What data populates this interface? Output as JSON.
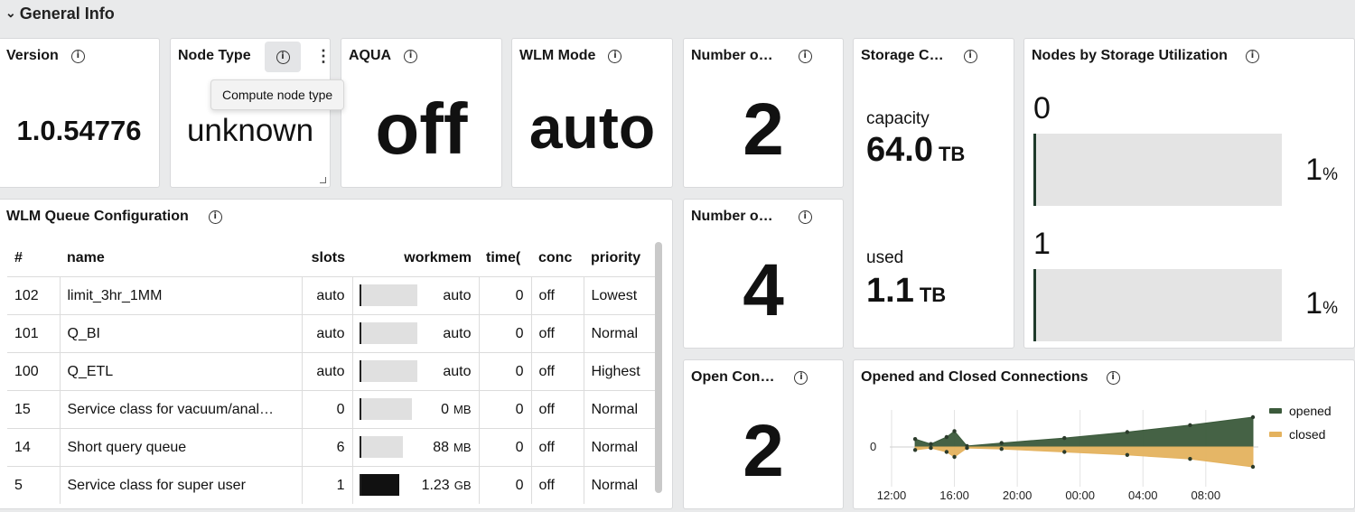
{
  "section": {
    "title": "General Info"
  },
  "version": {
    "title": "Version",
    "value": "1.0.54776"
  },
  "node_type": {
    "title": "Node Type",
    "value": "unknown",
    "tooltip": "Compute node type"
  },
  "aqua": {
    "title": "AQUA",
    "value": "off"
  },
  "wlm_mode": {
    "title": "WLM Mode",
    "value": "auto"
  },
  "number_of_1": {
    "title": "Number o…",
    "value": "2"
  },
  "number_of_2": {
    "title": "Number o…",
    "value": "4"
  },
  "open_connections": {
    "title": "Open Con…",
    "value": "2"
  },
  "storage": {
    "title": "Storage C…",
    "capacity_label": "capacity",
    "capacity_value": "64.0",
    "capacity_unit": "TB",
    "used_label": "used",
    "used_value": "1.1",
    "used_unit": "TB"
  },
  "nodes_storage": {
    "title": "Nodes by Storage Utilization",
    "nodes": [
      {
        "index": "0",
        "percent": "1",
        "unit": "%",
        "fraction": 0.01
      },
      {
        "index": "1",
        "percent": "1",
        "unit": "%",
        "fraction": 0.01
      }
    ]
  },
  "wlm_queue": {
    "title": "WLM Queue Configuration",
    "columns": [
      "#",
      "name",
      "slots",
      "workmem",
      "time(",
      "conc",
      "priority"
    ],
    "rows": [
      {
        "id": "102",
        "name": "limit_3hr_1MM",
        "slots": "auto",
        "workmem": "auto",
        "workmem_unit": "",
        "workmem_fraction": 0.0,
        "timeout": "0",
        "conc": "off",
        "priority": "Lowest"
      },
      {
        "id": "101",
        "name": "Q_BI",
        "slots": "auto",
        "workmem": "auto",
        "workmem_unit": "",
        "workmem_fraction": 0.0,
        "timeout": "0",
        "conc": "off",
        "priority": "Normal"
      },
      {
        "id": "100",
        "name": "Q_ETL",
        "slots": "auto",
        "workmem": "auto",
        "workmem_unit": "",
        "workmem_fraction": 0.0,
        "timeout": "0",
        "conc": "off",
        "priority": "Highest"
      },
      {
        "id": "15",
        "name": "Service class for vacuum/anal…",
        "slots": "0",
        "workmem": "0",
        "workmem_unit": "MB",
        "workmem_fraction": 0.0,
        "timeout": "0",
        "conc": "off",
        "priority": "Normal"
      },
      {
        "id": "14",
        "name": "Short query queue",
        "slots": "6",
        "workmem": "88",
        "workmem_unit": "MB",
        "workmem_fraction": 0.07,
        "timeout": "0",
        "conc": "off",
        "priority": "Normal"
      },
      {
        "id": "5",
        "name": "Service class for super user",
        "slots": "1",
        "workmem": "1.23",
        "workmem_unit": "GB",
        "workmem_fraction": 1.0,
        "timeout": "0",
        "conc": "off",
        "priority": "Normal"
      }
    ]
  },
  "chart_data": {
    "type": "area",
    "title": "Opened and Closed Connections",
    "x_ticks": [
      "12:00",
      "16:00",
      "20:00",
      "00:00",
      "04:00",
      "08:00"
    ],
    "y_ticks": [
      "0"
    ],
    "legend": [
      "opened",
      "closed"
    ],
    "legend_position": "right",
    "colors": {
      "opened": "#3b5a3b",
      "closed": "#e4b25e"
    },
    "series": [
      {
        "name": "opened",
        "x_hours": [
          13.5,
          14.5,
          15.5,
          16.0,
          16.8,
          19.0,
          23.0,
          3.0,
          7.0,
          11.0
        ],
        "values": [
          0.8,
          0.3,
          1.0,
          1.6,
          0.1,
          0.4,
          0.9,
          1.5,
          2.2,
          3.0
        ]
      },
      {
        "name": "closed",
        "x_hours": [
          13.5,
          14.5,
          15.5,
          16.0,
          16.8,
          19.0,
          23.0,
          3.0,
          7.0,
          11.0
        ],
        "values": [
          -0.3,
          -0.1,
          -0.5,
          -1.0,
          -0.1,
          -0.2,
          -0.5,
          -0.8,
          -1.2,
          -2.0
        ]
      }
    ]
  }
}
